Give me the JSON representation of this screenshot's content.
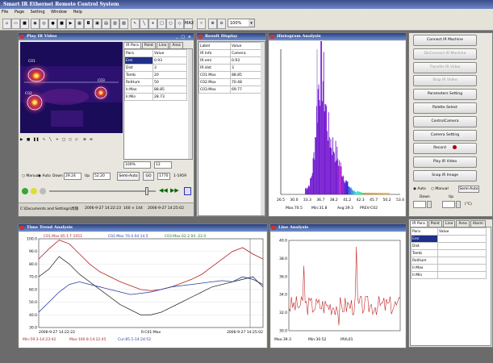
{
  "app": {
    "title": "Smart IR Ethernet Remote Control System",
    "menu": [
      "File",
      "Page",
      "Setting",
      "Window",
      "Help"
    ],
    "zoom": "100%",
    "toolbar_mode": "MAX"
  },
  "video": {
    "title": "Play IR Video",
    "labels": [
      "C01",
      "C02",
      "C03"
    ],
    "tabs": [
      "IR Para",
      "Point",
      "Line",
      "Area",
      "Alarm"
    ],
    "para_header": [
      "Para",
      "Value"
    ],
    "params": [
      [
        "Emi",
        "0.93"
      ],
      [
        "Dist",
        "3"
      ],
      [
        "Tamb",
        "20"
      ],
      [
        "RelHum",
        "50"
      ],
      [
        "Ir.Max",
        "88.85"
      ],
      [
        "Ir.Min",
        "28.73"
      ]
    ],
    "manual": "Manual",
    "auto": "Auto",
    "down_label": "Down",
    "down_value": "29.24",
    "up_label": "Up",
    "up_value": "52.20",
    "semiauto": "Semi-Auto",
    "go": "GO",
    "frame": "1770",
    "frame_total": "1-1959",
    "zoom": "100%",
    "palette_index": "12",
    "path": "C:\\Documents and Settings\\周期",
    "date": "2006-9-27 14:22:23",
    "res": "160 × 144",
    "date2": "2006-9-27 14:25:02",
    "progress_fraction": 0.9
  },
  "result": {
    "title": "Result Display",
    "header": [
      "Label",
      "Value"
    ],
    "rows": [
      [
        "IR Info",
        "Camera"
      ],
      [
        "IR.emi",
        "0.93"
      ],
      [
        "IR.dist",
        "3"
      ],
      [
        "C01.Max",
        "88.85"
      ],
      [
        "C02.Max",
        "70.48"
      ],
      [
        "C03.Max",
        "69.77"
      ]
    ]
  },
  "histogram": {
    "title": "Histogram Analysis",
    "xticks": [
      "26.5",
      "30.0",
      "33.3",
      "36.7",
      "38.2",
      "41.2",
      "42.3",
      "45.7",
      "50.2",
      "53.4"
    ],
    "footer": [
      "Max:70.5",
      "Min:31.8",
      "Avg:39.3",
      "PREV-C02"
    ]
  },
  "trend": {
    "title": "Time Trend Analysis",
    "legend": [
      "C01.Max 85.1 F 1051",
      "C02.Max 70.4 04 14.5",
      "C03.Max 62.2 04 -22.0"
    ],
    "yticks": [
      "100.0",
      "90.0",
      "80.0",
      "70.0",
      "60.0",
      "50.0",
      "40.0",
      "30.0"
    ],
    "x_start": "2006-9-27 14:22:22",
    "x_mid": "R-C01-Max",
    "x_end": "2006-9-27 14:25:02",
    "footer": [
      "Min:59.3-14:23:42",
      "Max:100.8-14:22:45",
      "Cur:85.1-14:24:52"
    ]
  },
  "line_analysis": {
    "title": "Line Analysis",
    "yticks": [
      "40.0",
      "38.0",
      "36.0",
      "34.0",
      "32.0",
      "30.0"
    ],
    "footer": [
      "Max:39.3",
      "Min:30.52",
      "IRVL01"
    ]
  },
  "right_panel": {
    "buttons": [
      {
        "label": "Connect IR Machine",
        "enabled": true
      },
      {
        "label": "DisConnect IR Machine",
        "enabled": false
      },
      {
        "label": "Transfer IR Video",
        "enabled": false
      },
      {
        "label": "Stop IR Video",
        "enabled": false
      },
      {
        "label": "Parameters Setting",
        "enabled": true
      },
      {
        "label": "Palette Select",
        "enabled": true
      },
      {
        "label": "ControlCamera",
        "enabled": true
      },
      {
        "label": "Camera Setting",
        "enabled": true
      },
      {
        "label": "Record",
        "enabled": true
      },
      {
        "label": "Play IR Video",
        "enabled": true
      },
      {
        "label": "Snap IR Image",
        "enabled": true
      }
    ],
    "auto": "Auto",
    "manual": "Manual",
    "semiauto": "Semi-Auto",
    "down": "Down",
    "up": "Up",
    "unit": "(°C)",
    "tabs": [
      "IR Para",
      "Point",
      "Line",
      "Area",
      "Alarm"
    ],
    "header": [
      "Para",
      "Value"
    ],
    "params": [
      "Emi",
      "Dist",
      "Tamb",
      "RelHum",
      "Ir.Max",
      "Ir.Min"
    ]
  }
}
